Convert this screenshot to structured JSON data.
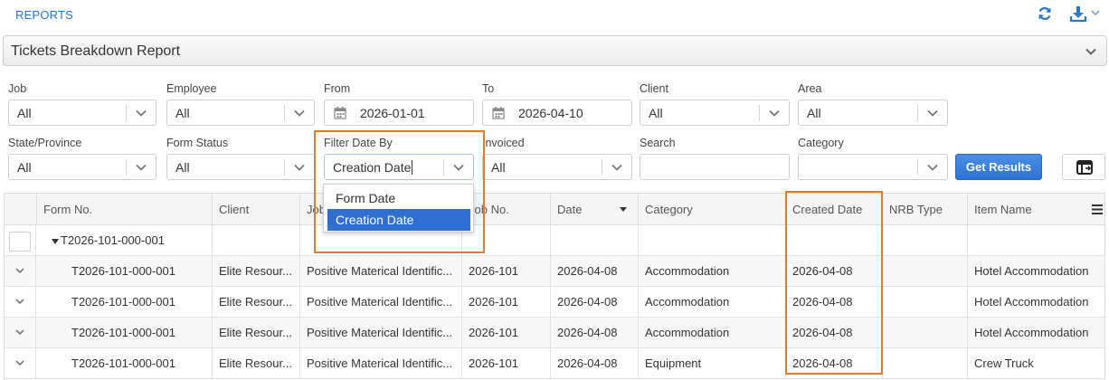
{
  "header": {
    "reports_label": "REPORTS"
  },
  "report": {
    "title": "Tickets Breakdown Report"
  },
  "filters": {
    "job": {
      "label": "Job",
      "value": "All"
    },
    "employee": {
      "label": "Employee",
      "value": "All"
    },
    "from": {
      "label": "From",
      "value": "2026-01-01"
    },
    "to": {
      "label": "To",
      "value": "2026-04-10"
    },
    "client": {
      "label": "Client",
      "value": "All"
    },
    "area": {
      "label": "Area",
      "value": "All"
    },
    "state": {
      "label": "State/Province",
      "value": "All"
    },
    "form_status": {
      "label": "Form Status",
      "value": "All"
    },
    "filter_date_by": {
      "label": "Filter Date By",
      "value": "Creation Date",
      "options": [
        "Form Date",
        "Creation Date"
      ]
    },
    "invoiced": {
      "label": "Invoiced",
      "value": "All"
    },
    "search": {
      "label": "Search",
      "value": ""
    },
    "category": {
      "label": "Category",
      "value": ""
    },
    "get_results_label": "Get Results"
  },
  "grid": {
    "columns": [
      "Form No.",
      "Client",
      "Job",
      "Job No.",
      "Date",
      "Category",
      "Created Date",
      "NRB Type",
      "Item Name"
    ],
    "group": "T2026-101-000-001",
    "rows": [
      [
        "T2026-101-000-001",
        "Elite Resour...",
        "Positive Materical Identific...",
        "2026-101",
        "2026-04-08",
        "Accommodation",
        "2026-04-08",
        "",
        "Hotel Accommodation"
      ],
      [
        "T2026-101-000-001",
        "Elite Resour...",
        "Positive Materical Identific...",
        "2026-101",
        "2026-04-08",
        "Accommodation",
        "2026-04-08",
        "",
        "Hotel Accommodation"
      ],
      [
        "T2026-101-000-001",
        "Elite Resour...",
        "Positive Materical Identific...",
        "2026-101",
        "2026-04-08",
        "Accommodation",
        "2026-04-08",
        "",
        "Hotel Accommodation"
      ],
      [
        "T2026-101-000-001",
        "Elite Resour...",
        "Positive Materical Identific...",
        "2026-101",
        "2026-04-08",
        "Equipment",
        "2026-04-08",
        "",
        "Crew Truck"
      ]
    ]
  },
  "colors": {
    "accent": "#2f6fd1",
    "highlight": "#e8782a"
  }
}
